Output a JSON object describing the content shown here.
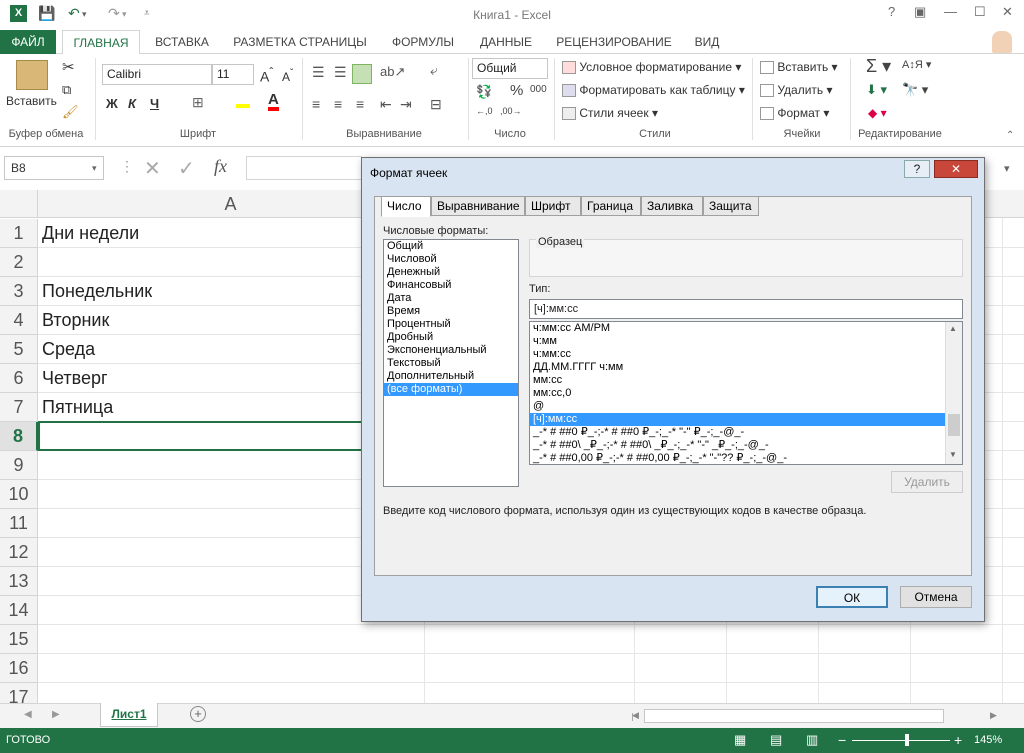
{
  "window": {
    "title": "Книга1 - Excel",
    "help": "?",
    "restore": "▣",
    "minimize": "—",
    "maximize": "☐",
    "close": "✕"
  },
  "ribbon_tabs": [
    "ФАЙЛ",
    "ГЛАВНАЯ",
    "ВСТАВКА",
    "РАЗМЕТКА СТРАНИЦЫ",
    "ФОРМУЛЫ",
    "ДАННЫЕ",
    "РЕЦЕНЗИРОВАНИЕ",
    "ВИД"
  ],
  "ribbon": {
    "paste": "Вставить",
    "font_name": "Calibri",
    "font_size": "11",
    "bold": "Ж",
    "italic": "К",
    "underline": "Ч",
    "number_format": "Общий",
    "cond_format": "Условное форматирование",
    "format_table": "Форматировать как таблицу",
    "cell_styles": "Стили ячеек",
    "insert": "Вставить",
    "delete": "Удалить",
    "format": "Формат",
    "groups": {
      "clipboard": "Буфер обмена",
      "font": "Шрифт",
      "alignment": "Выравнивание",
      "number": "Число",
      "styles": "Стили",
      "cells": "Ячейки",
      "editing": "Редактирование"
    }
  },
  "formula_bar": {
    "name_box": "B8",
    "fx": "fx"
  },
  "grid": {
    "column": "A",
    "rows": [
      "1",
      "2",
      "3",
      "4",
      "5",
      "6",
      "7",
      "8",
      "9",
      "10",
      "11",
      "12",
      "13",
      "14",
      "15",
      "16",
      "17"
    ],
    "cells": [
      "Дни недели",
      "",
      "Понедельник",
      "Вторник",
      "Среда",
      "Четверг",
      "Пятница"
    ]
  },
  "sheet_tab": "Лист1",
  "status": {
    "ready": "ГОТОВО",
    "zoom": "145%"
  },
  "dialog": {
    "title": "Формат ячеек",
    "tabs": [
      "Число",
      "Выравнивание",
      "Шрифт",
      "Граница",
      "Заливка",
      "Защита"
    ],
    "categories_label": "Числовые форматы:",
    "categories": [
      "Общий",
      "Числовой",
      "Денежный",
      "Финансовый",
      "Дата",
      "Время",
      "Процентный",
      "Дробный",
      "Экспоненциальный",
      "Текстовый",
      "Дополнительный",
      "(все форматы)"
    ],
    "selected_category": "(все форматы)",
    "sample_label": "Образец",
    "type_label": "Тип:",
    "type_value": "[ч]:мм:сс",
    "formats": [
      "ч:мм:сс AM/PM",
      "ч:мм",
      "ч:мм:сс",
      "ДД.ММ.ГГГГ ч:мм",
      "мм:сс",
      "мм:сс,0",
      "@",
      "[ч]:мм:сс",
      "_-* # ##0 ₽_-;-* # ##0 ₽_-;_-* \"-\" ₽_-;_-@_-",
      "_-* # ##0\\ _₽_-;-* # ##0\\ _₽_-;_-* \"-\" _₽_-;_-@_-",
      "_-* # ##0,00 ₽_-;-* # ##0,00 ₽_-;_-* \"-\"?? ₽_-;_-@_-"
    ],
    "selected_format": "[ч]:мм:сс",
    "delete_btn": "Удалить",
    "hint": "Введите код числового формата, используя один из существующих кодов в качестве образца.",
    "ok": "ОК",
    "cancel": "Отмена"
  },
  "colors": {
    "accent": "#217346",
    "selection": "#3399ff",
    "dialog_frame": "#d8e4f1"
  }
}
